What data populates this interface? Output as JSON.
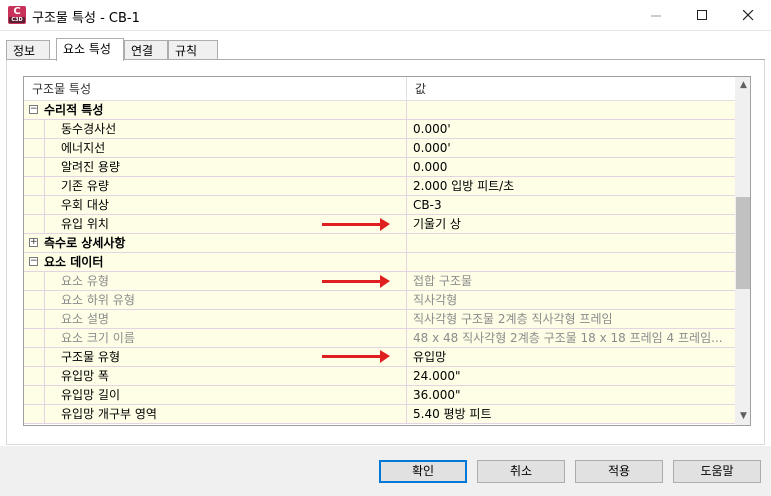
{
  "window": {
    "title": "구조물 특성 - CB-1",
    "icon_letter": "C",
    "icon_sub": "C3D"
  },
  "tabs": [
    {
      "label": "정보"
    },
    {
      "label": "요소 특성",
      "active": true
    },
    {
      "label": "연결"
    },
    {
      "label": "규칙"
    }
  ],
  "grid": {
    "header_property": "구조물 특성",
    "header_value": "값",
    "rows": [
      {
        "kind": "group",
        "expander": "⊟",
        "label": "수리적 특성",
        "value": ""
      },
      {
        "kind": "child",
        "label": "동수경사선",
        "value": "0.000'"
      },
      {
        "kind": "child",
        "label": "에너지선",
        "value": "0.000'"
      },
      {
        "kind": "child",
        "label": "알려진 용량",
        "value": "0.000"
      },
      {
        "kind": "child",
        "label": "기존 유량",
        "value": "2.000 입방 피트/초"
      },
      {
        "kind": "child",
        "label": "우회 대상",
        "value": "CB-3"
      },
      {
        "kind": "child",
        "label": "유입 위치",
        "value": "기울기 상"
      },
      {
        "kind": "group",
        "expander": "⊞",
        "label": "측수로 상세사항",
        "value": ""
      },
      {
        "kind": "group",
        "expander": "⊟",
        "label": "요소 데이터",
        "value": ""
      },
      {
        "kind": "child",
        "gray": true,
        "label": "요소 유형",
        "value": "접합 구조물"
      },
      {
        "kind": "child",
        "gray": true,
        "label": "요소 하위 유형",
        "value": "직사각형"
      },
      {
        "kind": "child",
        "gray": true,
        "label": "요소 설명",
        "value": "직사각형 구조물 2계층 직사각형 프레임"
      },
      {
        "kind": "child",
        "gray": true,
        "label": "요소 크기 이름",
        "value": "48 x 48 직사각형 2계층 구조물 18 x 18 프레임 4 프레임..."
      },
      {
        "kind": "child",
        "label": "구조물 유형",
        "value": "유입망"
      },
      {
        "kind": "child",
        "label": "유입망 폭",
        "value": "24.000\""
      },
      {
        "kind": "child",
        "label": "유입망 길이",
        "value": "36.000\""
      },
      {
        "kind": "child",
        "label": "유입망 개구부 영역",
        "value": "5.40 평방 피트"
      }
    ]
  },
  "buttons": {
    "ok": "확인",
    "cancel": "취소",
    "apply": "적용",
    "help": "도움말"
  },
  "colors": {
    "row_background": "#fefde6",
    "annotation_arrow": "#e02020",
    "default_button_border": "#0078d7"
  }
}
